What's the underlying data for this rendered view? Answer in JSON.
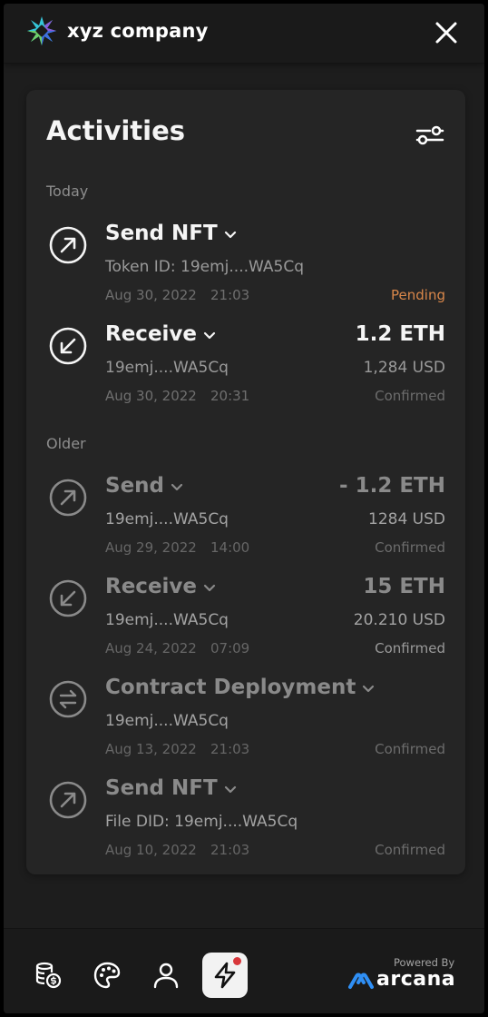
{
  "header": {
    "company_name": "xyz company",
    "logo_icon": "xyz-star-logo",
    "close_icon": "close-x"
  },
  "activities": {
    "title": "Activities",
    "filter_icon": "filter-sliders",
    "sections": {
      "today": {
        "label": "Today"
      },
      "older": {
        "label": "Older"
      }
    },
    "items": [
      {
        "type": "send",
        "title": "Send NFT",
        "subtitle": "Token ID: 19emj....WA5Cq",
        "date": "Aug 30, 2022",
        "time": "21:03",
        "amount": "",
        "usd": "",
        "status": "Pending"
      },
      {
        "type": "receive",
        "title": "Receive",
        "subtitle": "19emj....WA5Cq",
        "date": "Aug 30, 2022",
        "time": "20:31",
        "amount": "1.2 ETH",
        "usd": "1,284 USD",
        "status": "Confirmed"
      },
      {
        "type": "send",
        "title": "Send",
        "subtitle": "19emj....WA5Cq",
        "date": "Aug 29, 2022",
        "time": "14:00",
        "amount": "- 1.2 ETH",
        "usd": "1284 USD",
        "status": "Confirmed"
      },
      {
        "type": "receive",
        "title": "Receive",
        "subtitle": "19emj....WA5Cq",
        "date": "Aug 24, 2022",
        "time": "07:09",
        "amount": "15 ETH",
        "usd": "20.210 USD",
        "status": "Confirmed"
      },
      {
        "type": "contract",
        "title": "Contract Deployment",
        "subtitle": "19emj....WA5Cq",
        "date": "Aug 13, 2022",
        "time": "21:03",
        "amount": "",
        "usd": "",
        "status": "Confirmed"
      },
      {
        "type": "send",
        "title": "Send NFT",
        "subtitle": "File DID: 19emj....WA5Cq",
        "date": "Aug 10, 2022",
        "time": "21:03",
        "amount": "",
        "usd": "",
        "status": "Confirmed"
      }
    ]
  },
  "bottom_nav": {
    "items": [
      "coins-icon",
      "palette-icon",
      "profile-icon",
      "activity-bolt-icon"
    ],
    "active": "activity-bolt-icon"
  },
  "footer": {
    "powered_by": "Powered By",
    "brand": "arcana"
  },
  "colors": {
    "background": "#1d1d1d",
    "card": "#252525",
    "pending": "#d9874a",
    "notification": "#d8373b",
    "arcana_blue": "#2f8ff5"
  }
}
